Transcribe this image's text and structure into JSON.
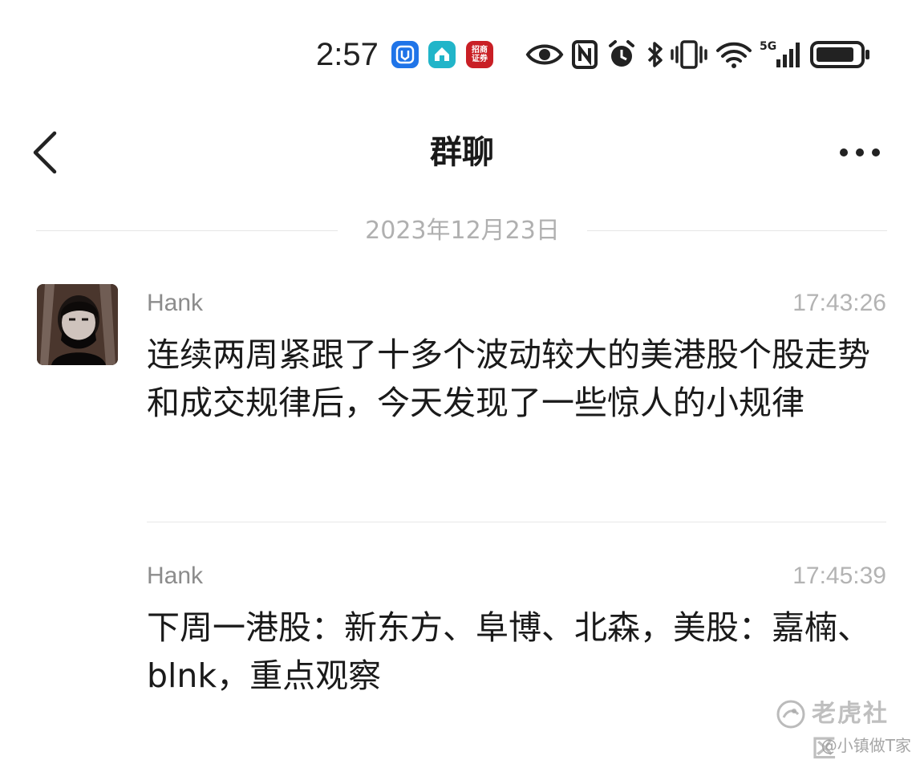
{
  "status_bar": {
    "time": "2:57",
    "app_icons": [
      "app-notification-blue",
      "app-notification-home",
      "招商证券"
    ],
    "system_icons": [
      "eye-icon",
      "nfc-icon",
      "alarm-icon",
      "bluetooth-icon",
      "vibrate-icon",
      "wifi-icon",
      "signal-5g-icon",
      "battery-icon"
    ],
    "network_label": "5G"
  },
  "header": {
    "title": "群聊",
    "back_icon": "chevron-left-icon",
    "more_icon": "more-horizontal-icon"
  },
  "date_separator": "2023年12月23日",
  "messages": [
    {
      "sender": "Hank",
      "time": "17:43:26",
      "text": "连续两周紧跟了十多个波动较大的美港股个股走势和成交规律后，今天发现了一些惊人的小规律"
    },
    {
      "sender": "Hank",
      "time": "17:45:39",
      "text": "下周一港股：新东方、阜博、北森，美股：嘉楠、blnk，重点观察"
    }
  ],
  "watermark": {
    "brand": "老虎社区",
    "user": "@小镇做T家"
  },
  "colors": {
    "background": "#ffffff",
    "text_primary": "#1a1a1a",
    "text_secondary": "#8c8c8c",
    "separator": "#e6e6e6"
  }
}
